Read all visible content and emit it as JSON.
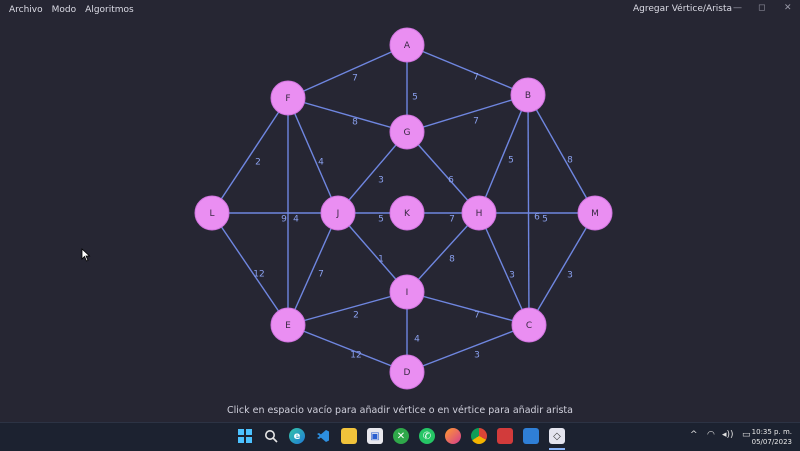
{
  "menu": {
    "items": [
      "Archivo",
      "Modo",
      "Algoritmos"
    ]
  },
  "mode_label": "Agregar Vértice/Arista",
  "window_controls": {
    "minimize": "—",
    "maximize": "◻",
    "close": "✕"
  },
  "graph": {
    "vertices": [
      {
        "id": "A"
      },
      {
        "id": "B"
      },
      {
        "id": "F"
      },
      {
        "id": "G"
      },
      {
        "id": "L"
      },
      {
        "id": "J"
      },
      {
        "id": "K"
      },
      {
        "id": "H"
      },
      {
        "id": "M"
      },
      {
        "id": "I"
      },
      {
        "id": "E"
      },
      {
        "id": "C"
      },
      {
        "id": "D"
      }
    ],
    "edges": [
      {
        "from": "A",
        "to": "F",
        "weight": "7"
      },
      {
        "from": "A",
        "to": "B",
        "weight": "7"
      },
      {
        "from": "A",
        "to": "G",
        "weight": "5"
      },
      {
        "from": "F",
        "to": "G",
        "weight": "8"
      },
      {
        "from": "B",
        "to": "G",
        "weight": "7"
      },
      {
        "from": "F",
        "to": "L",
        "weight": "2"
      },
      {
        "from": "F",
        "to": "J",
        "weight": "4"
      },
      {
        "from": "F",
        "to": "E",
        "weight": "9"
      },
      {
        "from": "G",
        "to": "J",
        "weight": "3"
      },
      {
        "from": "G",
        "to": "H",
        "weight": "6"
      },
      {
        "from": "B",
        "to": "H",
        "weight": "5"
      },
      {
        "from": "B",
        "to": "M",
        "weight": "8"
      },
      {
        "from": "B",
        "to": "C",
        "weight": "6"
      },
      {
        "from": "L",
        "to": "J",
        "weight": "4"
      },
      {
        "from": "J",
        "to": "K",
        "weight": "5"
      },
      {
        "from": "K",
        "to": "H",
        "weight": "7"
      },
      {
        "from": "H",
        "to": "M",
        "weight": "5"
      },
      {
        "from": "L",
        "to": "E",
        "weight": "12"
      },
      {
        "from": "J",
        "to": "E",
        "weight": "7"
      },
      {
        "from": "J",
        "to": "I",
        "weight": "1"
      },
      {
        "from": "H",
        "to": "I",
        "weight": "8"
      },
      {
        "from": "H",
        "to": "C",
        "weight": "3"
      },
      {
        "from": "M",
        "to": "C",
        "weight": "3"
      },
      {
        "from": "I",
        "to": "E",
        "weight": "2"
      },
      {
        "from": "I",
        "to": "C",
        "weight": "7"
      },
      {
        "from": "I",
        "to": "D",
        "weight": "4"
      },
      {
        "from": "E",
        "to": "D",
        "weight": "12"
      },
      {
        "from": "D",
        "to": "C",
        "weight": "3"
      }
    ]
  },
  "status_hint": "Click en espacio vacío para añadir vértice o en vértice para añadir arista",
  "taskbar": {
    "apps": [
      "windows-start",
      "search",
      "edge",
      "vscode",
      "file-explorer",
      "store",
      "xbox",
      "whatsapp",
      "firefox",
      "chrome",
      "app-red",
      "app-blue",
      "app-graph"
    ],
    "tray": {
      "chevron": "^",
      "wifi": "◠",
      "volume": "◂))",
      "battery": "▭"
    },
    "time": "10:35 p. m.",
    "date": "05/07/2023"
  },
  "colors": {
    "background": "#262633",
    "vertex": "#ea8ef2",
    "edge": "#6f86e0",
    "weight": "#8aa0ee"
  }
}
